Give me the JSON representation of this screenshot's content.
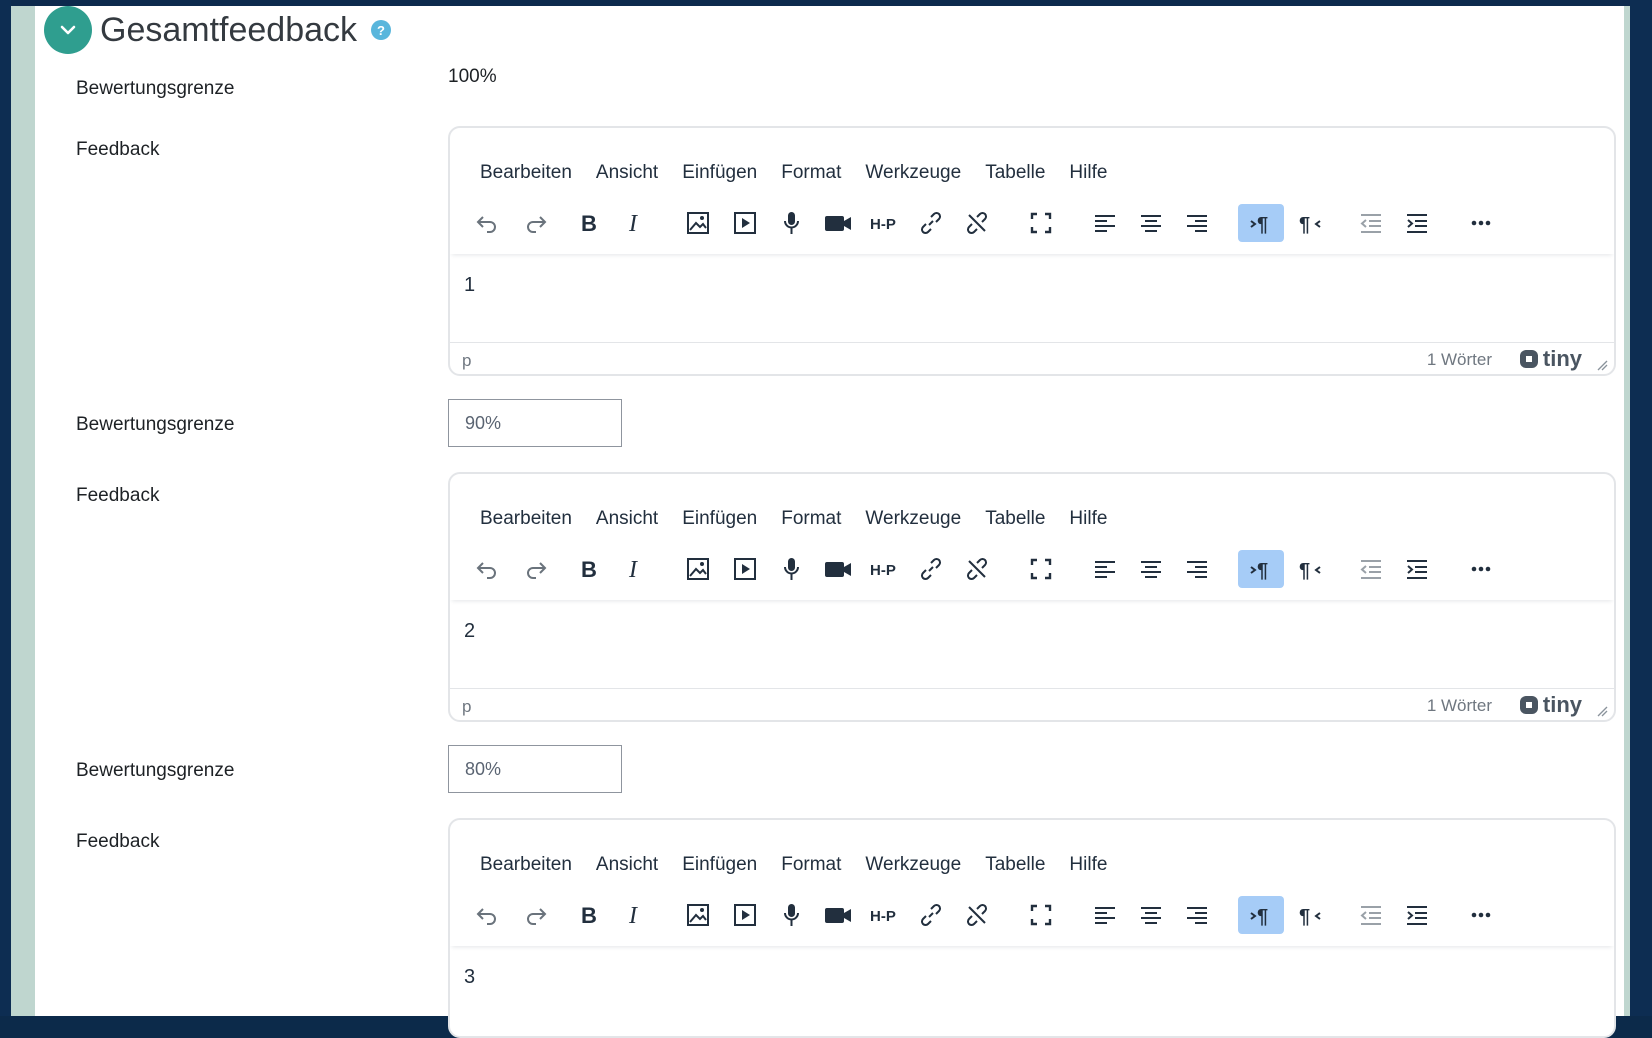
{
  "section": {
    "title": "Gesamtfeedback"
  },
  "labels": {
    "grade_boundary": "Bewertungsgrenze",
    "feedback": "Feedback"
  },
  "top_boundary_value": "100%",
  "editor_menu": [
    "Bearbeiten",
    "Ansicht",
    "Einfügen",
    "Format",
    "Werkzeuge",
    "Tabelle",
    "Hilfe"
  ],
  "toolbar_icons": [
    "undo-icon",
    "redo-icon",
    "bold-icon",
    "italic-icon",
    "image-icon",
    "media-icon",
    "record-audio-icon",
    "record-video-icon",
    "h5p-icon",
    "link-icon",
    "unlink-icon",
    "fullscreen-icon",
    "align-left-icon",
    "align-center-icon",
    "align-right-icon",
    "ltr-icon",
    "rtl-icon",
    "outdent-icon",
    "indent-icon",
    "more-icon"
  ],
  "editors": [
    {
      "content": "1",
      "path": "p",
      "word_count": "1 Wörter"
    },
    {
      "content": "2",
      "path": "p",
      "word_count": "1 Wörter"
    },
    {
      "content": "3"
    }
  ],
  "boundaries": [
    {
      "value": "90%"
    },
    {
      "value": "80%"
    }
  ],
  "brand": "tiny",
  "colors": {
    "accent": "#2f9e8f",
    "help": "#59b6dc",
    "active_button": "#a6ccf7",
    "frame": "#0d2d52"
  }
}
